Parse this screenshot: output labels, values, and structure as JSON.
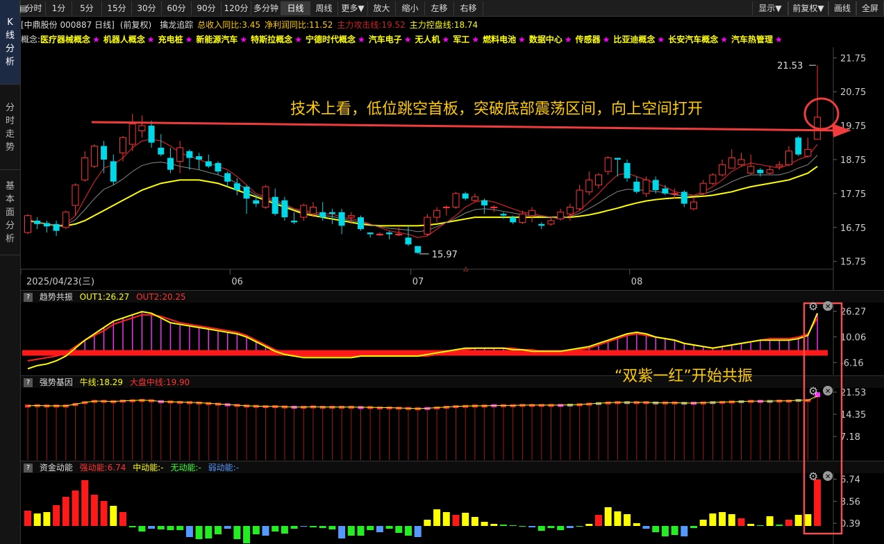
{
  "sidebar": {
    "tabs": [
      {
        "label": "K线分析",
        "active": true
      },
      {
        "label": "分时走势"
      },
      {
        "label": "基本面分析"
      }
    ]
  },
  "toolbar": {
    "left": [
      "分时",
      "1分",
      "5分",
      "15分",
      "30分",
      "60分",
      "90分",
      "120分",
      "多分钟",
      "日线",
      "周线",
      "更多▼",
      "放大",
      "缩小",
      "左移",
      "右移"
    ],
    "active": "日线",
    "right": [
      "显示▼",
      "前复权▼",
      "画线",
      "全屏"
    ]
  },
  "info": {
    "stock": "[中鼎股份 000887 日线]",
    "adj": "(前复权)",
    "indicator": "擒龙追踪",
    "items": [
      {
        "label": "总收入同比:",
        "value": "3.45",
        "color": "#ffcc00"
      },
      {
        "label": "净利润同比:",
        "value": "11.52",
        "color": "#ffcc00"
      },
      {
        "label": "主力攻击线:",
        "value": "19.52",
        "color": "#cc2222"
      },
      {
        "label": "主力控盘线:",
        "value": "18.74",
        "color": "#ffff00"
      }
    ]
  },
  "concepts": {
    "prefix": "概念:",
    "items": [
      "医疗器械概念",
      "机器人概念",
      "充电桩",
      "新能源汽车",
      "特斯拉概念",
      "宁德时代概念",
      "汽车电子",
      "无人机",
      "军工",
      "燃料电池",
      "数据中心",
      "传感器",
      "比亚迪概念",
      "长安汽车概念",
      "汽车热管理"
    ]
  },
  "main": {
    "yticks": [
      "21.75",
      "20.75",
      "19.75",
      "18.75",
      "17.75",
      "16.75",
      "15.75"
    ],
    "xlabels": [
      {
        "label": "2025/04/23(三)",
        "pos": 0
      },
      {
        "label": "06",
        "pos": 22
      },
      {
        "label": "07",
        "pos": 41
      },
      {
        "label": "08",
        "pos": 64
      }
    ],
    "high_label": "21.53",
    "low_label": "15.97",
    "annotation": "技术上看，低位跳空首板，突破底部震荡区间，向上空间打开"
  },
  "panel1": {
    "title": "趋势共振",
    "out1": "OUT1:26.27",
    "out2": "OUT2:20.25",
    "yticks": [
      "26.27",
      "10.06",
      "-6.16"
    ],
    "annotation": "“双紫一红”开始共振"
  },
  "panel2": {
    "title": "强势基因",
    "niu": "牛线:18.29",
    "dapan": "大盘中线:19.90",
    "yticks": [
      "21.53",
      "14.35",
      "7.18"
    ]
  },
  "panel3": {
    "title": "资金动能",
    "strong": "强动能:6.74",
    "mid": "中动能:-",
    "none": "无动能:-",
    "weak": "弱动能:-",
    "yticks": [
      "6.74",
      "3.56",
      "0.39"
    ]
  },
  "chart_data": {
    "type": "candlestick",
    "ylim": [
      15.6,
      21.9
    ],
    "candles": [
      [
        16.6,
        17.1,
        17.15,
        16.55
      ],
      [
        16.95,
        16.85,
        17.05,
        16.7
      ],
      [
        16.88,
        16.78,
        16.95,
        16.6
      ],
      [
        16.85,
        16.65,
        16.95,
        16.5
      ],
      [
        16.75,
        17.2,
        17.25,
        16.7
      ],
      [
        17.4,
        18.0,
        18.05,
        17.1
      ],
      [
        18.15,
        18.8,
        19.0,
        18.1
      ],
      [
        18.55,
        19.15,
        19.2,
        18.5
      ],
      [
        19.15,
        18.75,
        19.3,
        18.35
      ],
      [
        18.7,
        18.1,
        18.9,
        18.0
      ],
      [
        18.95,
        19.4,
        19.45,
        18.7
      ],
      [
        19.2,
        19.8,
        20.1,
        19.0
      ],
      [
        19.6,
        19.75,
        20.05,
        19.4
      ],
      [
        19.75,
        19.25,
        19.9,
        19.1
      ],
      [
        19.1,
        18.9,
        19.5,
        18.85
      ],
      [
        18.8,
        18.45,
        19.1,
        18.35
      ],
      [
        18.7,
        19.1,
        19.3,
        18.35
      ],
      [
        19.0,
        18.8,
        19.05,
        18.45
      ],
      [
        18.85,
        18.75,
        18.95,
        18.45
      ],
      [
        18.7,
        18.55,
        18.9,
        18.5
      ],
      [
        18.65,
        18.4,
        18.7,
        18.3
      ],
      [
        18.35,
        18.1,
        18.4,
        17.95
      ],
      [
        18.05,
        17.85,
        18.2,
        17.7
      ],
      [
        17.95,
        17.6,
        18.0,
        17.15
      ],
      [
        17.55,
        17.45,
        17.7,
        17.35
      ],
      [
        17.35,
        17.95,
        18.0,
        17.3
      ],
      [
        17.65,
        17.15,
        17.9,
        17.1
      ],
      [
        17.55,
        17.05,
        17.65,
        16.95
      ],
      [
        16.95,
        16.9,
        17.2,
        16.85
      ],
      [
        17.05,
        17.4,
        17.45,
        16.95
      ],
      [
        17.15,
        17.35,
        17.5,
        17.05
      ],
      [
        17.2,
        17.05,
        17.5,
        16.95
      ],
      [
        17.2,
        17.15,
        17.3,
        16.85
      ],
      [
        17.2,
        16.8,
        17.3,
        16.55
      ],
      [
        17.05,
        17.1,
        17.2,
        16.85
      ],
      [
        17.05,
        16.7,
        17.1,
        16.65
      ],
      [
        16.6,
        16.55,
        16.6,
        16.45
      ],
      [
        16.55,
        16.55,
        16.6,
        16.5
      ],
      [
        16.6,
        16.55,
        16.65,
        16.4
      ],
      [
        16.55,
        16.55,
        16.75,
        16.5
      ],
      [
        16.45,
        16.25,
        16.8,
        16.2
      ],
      [
        16.2,
        16.0,
        16.2,
        15.97
      ],
      [
        16.55,
        17.05,
        17.15,
        16.5
      ],
      [
        17.05,
        17.25,
        17.35,
        16.9
      ],
      [
        17.35,
        17.35,
        17.4,
        17.1
      ],
      [
        17.35,
        17.75,
        17.8,
        17.3
      ],
      [
        17.75,
        17.6,
        17.8,
        17.55
      ],
      [
        17.55,
        17.65,
        17.75,
        17.5
      ],
      [
        17.55,
        17.4,
        17.6,
        17.15
      ],
      [
        17.35,
        17.35,
        17.4,
        17.2
      ],
      [
        17.15,
        17.1,
        17.2,
        17.0
      ],
      [
        17.05,
        16.9,
        17.1,
        16.85
      ],
      [
        16.9,
        17.15,
        17.25,
        16.85
      ],
      [
        17.1,
        17.25,
        17.35,
        16.9
      ],
      [
        16.85,
        16.8,
        16.9,
        16.7
      ],
      [
        16.85,
        16.95,
        17.05,
        16.8
      ],
      [
        17.0,
        17.2,
        17.3,
        16.95
      ],
      [
        17.15,
        17.35,
        17.45,
        16.95
      ],
      [
        17.3,
        17.85,
        18.0,
        17.25
      ],
      [
        17.8,
        18.15,
        18.4,
        17.7
      ],
      [
        18.0,
        18.3,
        18.35,
        17.9
      ],
      [
        18.4,
        18.8,
        18.85,
        18.3
      ],
      [
        18.8,
        18.75,
        18.8,
        18.25
      ],
      [
        18.65,
        18.2,
        18.75,
        18.1
      ],
      [
        18.1,
        17.8,
        18.25,
        17.75
      ],
      [
        17.75,
        18.15,
        18.25,
        17.65
      ],
      [
        18.15,
        17.85,
        18.25,
        17.75
      ],
      [
        17.9,
        17.75,
        18.0,
        17.7
      ],
      [
        17.75,
        17.75,
        17.9,
        17.6
      ],
      [
        17.8,
        17.45,
        17.85,
        17.35
      ],
      [
        17.3,
        17.5,
        17.65,
        17.25
      ],
      [
        17.75,
        18.05,
        18.15,
        17.7
      ],
      [
        18.05,
        18.3,
        18.35,
        18.0
      ],
      [
        18.3,
        18.6,
        18.75,
        18.25
      ],
      [
        18.5,
        18.8,
        19.05,
        18.5
      ],
      [
        18.6,
        18.75,
        18.95,
        18.55
      ],
      [
        18.35,
        18.55,
        18.9,
        18.3
      ],
      [
        18.45,
        18.35,
        18.5,
        18.25
      ],
      [
        18.35,
        18.45,
        18.55,
        18.3
      ],
      [
        18.55,
        18.6,
        18.7,
        18.45
      ],
      [
        18.6,
        19.0,
        19.15,
        18.55
      ],
      [
        19.4,
        18.9,
        19.45,
        18.85
      ],
      [
        18.85,
        19.05,
        19.4,
        18.8
      ],
      [
        19.35,
        20.0,
        21.53,
        19.35
      ]
    ],
    "ma5": [
      17.0,
      16.9,
      16.85,
      16.8,
      16.85,
      17.1,
      17.6,
      18.1,
      18.5,
      18.6,
      18.8,
      19.1,
      19.3,
      19.35,
      19.3,
      19.15,
      18.95,
      18.85,
      18.75,
      18.65,
      18.55,
      18.45,
      18.25,
      18.0,
      17.75,
      17.65,
      17.55,
      17.45,
      17.3,
      17.25,
      17.2,
      17.15,
      17.15,
      17.05,
      17.0,
      16.95,
      16.85,
      16.75,
      16.65,
      16.6,
      16.55,
      16.45,
      16.5,
      16.7,
      16.9,
      17.1,
      17.35,
      17.5,
      17.55,
      17.5,
      17.4,
      17.3,
      17.2,
      17.15,
      17.1,
      17.05,
      17.0,
      17.1,
      17.25,
      17.5,
      17.75,
      18.05,
      18.3,
      18.35,
      18.25,
      18.15,
      18.05,
      17.95,
      17.8,
      17.75,
      17.7,
      17.8,
      17.95,
      18.15,
      18.4,
      18.55,
      18.65,
      18.6,
      18.55,
      18.5,
      18.6,
      18.75,
      18.85,
      19.2
    ],
    "ma20": [
      16.95,
      16.9,
      16.85,
      16.8,
      16.8,
      16.85,
      16.95,
      17.1,
      17.25,
      17.4,
      17.55,
      17.7,
      17.85,
      17.95,
      18.05,
      18.1,
      18.15,
      18.15,
      18.15,
      18.1,
      18.05,
      17.95,
      17.85,
      17.75,
      17.65,
      17.55,
      17.45,
      17.35,
      17.25,
      17.15,
      17.1,
      17.05,
      17.0,
      16.95,
      16.9,
      16.85,
      16.82,
      16.8,
      16.8,
      16.8,
      16.8,
      16.8,
      16.82,
      16.85,
      16.9,
      16.95,
      17.0,
      17.05,
      17.05,
      17.05,
      17.05,
      17.05,
      17.05,
      17.05,
      17.05,
      17.05,
      17.05,
      17.05,
      17.08,
      17.12,
      17.18,
      17.25,
      17.32,
      17.4,
      17.47,
      17.53,
      17.57,
      17.6,
      17.62,
      17.63,
      17.65,
      17.67,
      17.7,
      17.75,
      17.8,
      17.88,
      17.95,
      18.0,
      18.05,
      18.1,
      18.15,
      18.25,
      18.35,
      18.55
    ],
    "panel1": {
      "ylim": [
        -12,
        30
      ],
      "out1": [
        -10,
        -8,
        -7,
        -5,
        -2,
        3,
        8,
        12,
        16,
        20,
        22,
        24,
        26,
        25,
        22,
        19,
        18,
        17,
        16,
        15,
        14,
        13,
        12,
        10,
        7,
        4,
        1,
        -1,
        -2,
        -3,
        -3,
        -3,
        -3,
        -3,
        -3,
        -2,
        -2,
        -2,
        -2,
        -2,
        -2,
        -2,
        -1,
        0,
        1,
        2,
        3,
        3,
        3,
        3,
        3,
        2,
        2,
        1,
        1,
        1,
        1,
        2,
        3,
        4,
        6,
        8,
        10,
        12,
        13,
        12,
        10,
        9,
        8,
        6,
        5,
        4,
        3,
        4,
        5,
        6,
        7,
        8,
        8,
        8,
        8,
        9,
        11,
        25
      ],
      "out2": [
        -5,
        -4,
        -3,
        -2,
        0,
        4,
        8,
        11,
        14,
        18,
        20,
        22,
        24,
        24,
        23,
        21,
        19,
        18,
        17,
        16,
        15,
        14,
        13,
        11,
        8,
        5,
        2,
        0,
        -1,
        -2,
        -2,
        -2,
        -2,
        -2,
        -2,
        -2,
        -2,
        -2,
        -2,
        -2,
        -2,
        -2,
        -2,
        -1,
        0,
        1,
        2,
        3,
        3,
        3,
        3,
        3,
        2,
        2,
        1,
        1,
        1,
        1,
        2,
        3,
        5,
        7,
        9,
        11,
        12,
        11,
        10,
        9,
        8,
        6,
        5,
        4,
        3,
        4,
        5,
        6,
        7,
        8,
        9,
        9,
        9,
        10,
        12,
        22
      ],
      "baseline": 0
    },
    "panel2": {
      "ylim": [
        0,
        22
      ],
      "bars": [
        16.8,
        16.9,
        16.8,
        16.8,
        16.8,
        17.3,
        17.9,
        18.3,
        18.3,
        18.2,
        18.4,
        18.5,
        18.6,
        18.5,
        18.2,
        18.1,
        18.0,
        17.9,
        17.8,
        17.6,
        17.4,
        17.2,
        17.0,
        16.8,
        16.7,
        16.6,
        16.6,
        16.5,
        16.4,
        16.4,
        16.5,
        16.4,
        16.4,
        16.4,
        16.4,
        16.3,
        16.3,
        16.2,
        16.2,
        16.1,
        16.0,
        15.9,
        16.0,
        16.2,
        16.4,
        16.6,
        16.7,
        16.8,
        16.8,
        16.9,
        16.9,
        16.9,
        17.0,
        17.0,
        17.0,
        17.0,
        17.0,
        17.1,
        17.2,
        17.4,
        17.6,
        17.8,
        17.9,
        17.9,
        17.9,
        17.9,
        17.8,
        17.8,
        17.8,
        17.7,
        17.7,
        17.8,
        17.9,
        18.0,
        18.1,
        18.2,
        18.3,
        18.3,
        18.3,
        18.4,
        18.4,
        18.6,
        18.6,
        19.9
      ]
    },
    "panel3": {
      "ylim": [
        -2.6,
        7.4
      ],
      "values": [
        2.2,
        1.8,
        2.0,
        3.0,
        4.2,
        5.1,
        6.6,
        4.5,
        3.6,
        2.9,
        2.0,
        -0.2,
        -0.8,
        -0.4,
        -0.5,
        -0.6,
        -0.6,
        -1.6,
        -1.9,
        -1.8,
        -1.2,
        -0.4,
        -1.9,
        -2.5,
        -1.2,
        -1.4,
        -0.8,
        -1.1,
        -0.4,
        -0.1,
        -0.2,
        -0.3,
        -0.5,
        -1.8,
        -1.4,
        -1.4,
        -0.6,
        -0.9,
        -0.4,
        -1.0,
        -1.4,
        -1.6,
        0.9,
        2.4,
        2.0,
        1.6,
        1.9,
        1.3,
        0.6,
        0.3,
        0.2,
        0.1,
        0.0,
        -0.2,
        -0.7,
        -0.3,
        -0.6,
        -0.3,
        -0.1,
        0.3,
        1.6,
        2.7,
        2.1,
        1.7,
        0.4,
        -0.4,
        -0.9,
        -1.5,
        -1.3,
        -1.5,
        -0.3,
        0.9,
        1.8,
        2.0,
        1.7,
        1.1,
        0.3,
        0.1,
        1.4,
        0.2,
        0.9,
        1.6,
        1.7,
        6.7
      ]
    }
  }
}
